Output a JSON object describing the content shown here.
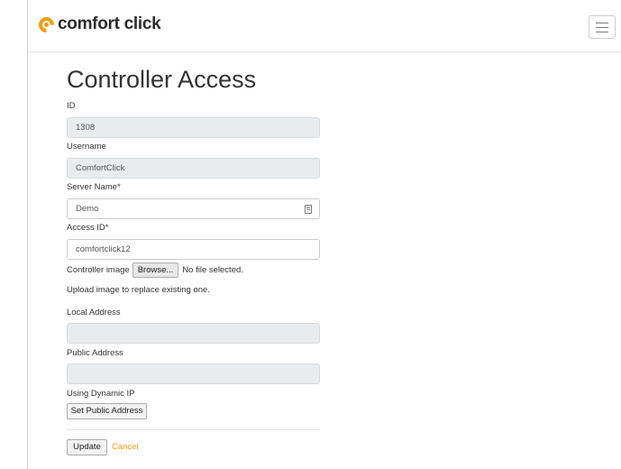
{
  "brand": {
    "name": "comfort click",
    "accent": "#f39c12"
  },
  "page": {
    "title": "Controller Access"
  },
  "form": {
    "id": {
      "label": "ID",
      "value": "1308"
    },
    "username": {
      "label": "Username",
      "value": "ComfortClick"
    },
    "server_name": {
      "label": "Server Name*",
      "value": "Demo"
    },
    "access_id": {
      "label": "Access ID*",
      "value": "comfortclick12"
    },
    "controller_image": {
      "label": "Controller image",
      "browse_label": "Browse...",
      "status": "No file selected."
    },
    "upload_help": "Upload image to replace existing one.",
    "local_address": {
      "label": "Local Address",
      "value": ""
    },
    "public_address": {
      "label": "Public Address",
      "value": ""
    },
    "dynamic_ip": {
      "label": "Using Dynamic IP",
      "button": "Set Public Address"
    }
  },
  "actions": {
    "update": "Update",
    "cancel": "Cancel"
  },
  "icons": {
    "menu": "hamburger-menu-icon",
    "server_field": "contact-card-icon"
  }
}
